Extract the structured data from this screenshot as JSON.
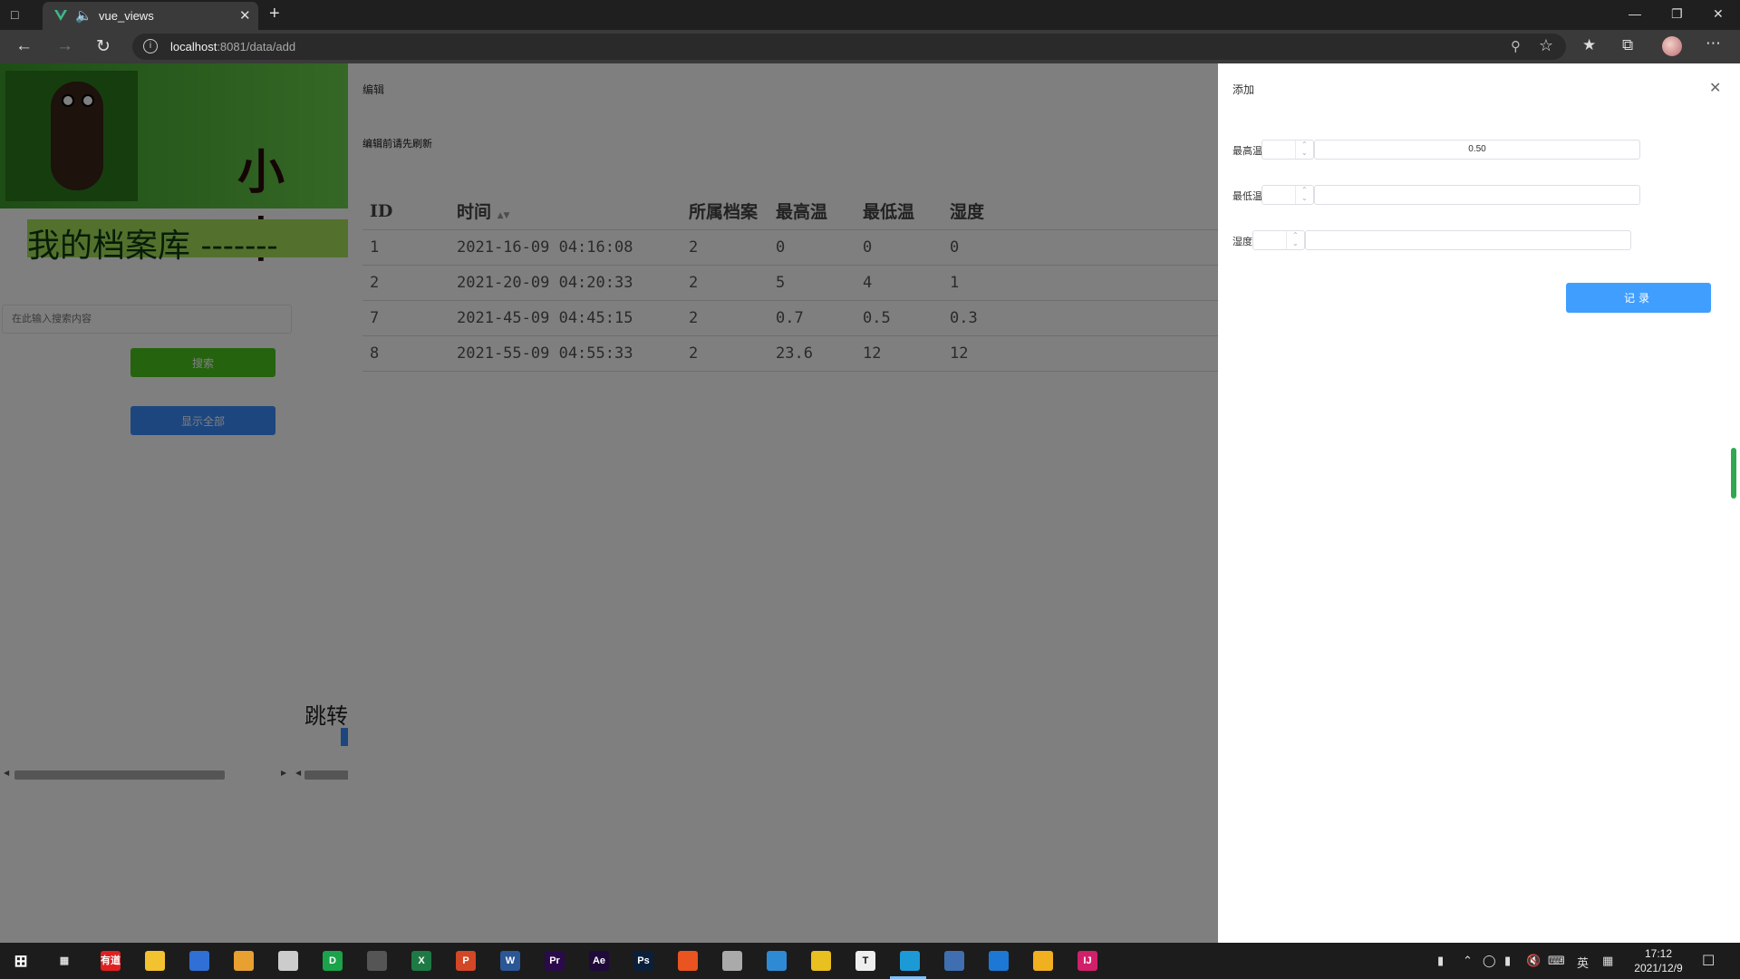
{
  "browser": {
    "tab_title": "vue_views",
    "url_host": "localhost",
    "url_rest": ":8081/data/add"
  },
  "background_page": {
    "banner_text": "小 中",
    "library_title": "我的档案库 -------",
    "search_placeholder": "在此输入搜索内容",
    "search_button": "搜索",
    "show_all_button": "显示全部",
    "jump_label": "跳转"
  },
  "edit_drawer": {
    "title": "编辑",
    "hint": "编辑前请先刷新",
    "columns": [
      "ID",
      "时间",
      "所属档案",
      "最高温",
      "最低温",
      "湿度"
    ],
    "rows": [
      {
        "id": "1",
        "time": "2021-16-09 04:16:08",
        "archive": "2",
        "max": "0",
        "min": "0",
        "humidity": "0"
      },
      {
        "id": "2",
        "time": "2021-20-09 04:20:33",
        "archive": "2",
        "max": "5",
        "min": "4",
        "humidity": "1"
      },
      {
        "id": "7",
        "time": "2021-45-09 04:45:15",
        "archive": "2",
        "max": "0.7",
        "min": "0.5",
        "humidity": "0.3"
      },
      {
        "id": "8",
        "time": "2021-55-09 04:55:33",
        "archive": "2",
        "max": "23.6",
        "min": "12",
        "humidity": "12"
      }
    ]
  },
  "add_drawer": {
    "title": "添加",
    "fields": [
      {
        "label": "最高温",
        "value": "0.50"
      },
      {
        "label": "最低温",
        "value": ""
      },
      {
        "label": "湿度",
        "value": ""
      }
    ],
    "submit_label": "记录"
  },
  "taskbar": {
    "apps": [
      {
        "name": "youdao",
        "label": "有道",
        "color": "#e02020"
      },
      {
        "name": "file-explorer",
        "label": "",
        "color": "#f2c230"
      },
      {
        "name": "mail",
        "label": "",
        "color": "#2f6fd6"
      },
      {
        "name": "bt",
        "label": "",
        "color": "#e8a030"
      },
      {
        "name": "files",
        "label": "",
        "color": "#ccc"
      },
      {
        "name": "d-app",
        "label": "D",
        "color": "#1aa34a"
      },
      {
        "name": "terminal",
        "label": "",
        "color": "#555"
      },
      {
        "name": "excel",
        "label": "X",
        "color": "#1e7a44"
      },
      {
        "name": "powerpoint",
        "label": "P",
        "color": "#d24726"
      },
      {
        "name": "word",
        "label": "W",
        "color": "#2b5797"
      },
      {
        "name": "premiere",
        "label": "Pr",
        "color": "#2a0a4a"
      },
      {
        "name": "after-effects",
        "label": "Ae",
        "color": "#1f0a3a"
      },
      {
        "name": "photoshop",
        "label": "Ps",
        "color": "#0a1f3a"
      },
      {
        "name": "ubuntu",
        "label": "",
        "color": "#e95420"
      },
      {
        "name": "app-b",
        "label": "",
        "color": "#aaa"
      },
      {
        "name": "app-c",
        "label": "",
        "color": "#2f8ad6"
      },
      {
        "name": "chrome",
        "label": "",
        "color": "#e8c020"
      },
      {
        "name": "typora",
        "label": "T",
        "color": "#eee"
      },
      {
        "name": "edge",
        "label": "",
        "color": "#1c9ad6"
      },
      {
        "name": "app-d",
        "label": "",
        "color": "#3f6fb0"
      },
      {
        "name": "vscode",
        "label": "",
        "color": "#1c78d4"
      },
      {
        "name": "app-e",
        "label": "",
        "color": "#f0b020"
      },
      {
        "name": "intellij",
        "label": "IJ",
        "color": "#d0206a"
      }
    ],
    "ime": "英",
    "time": "17:12",
    "date": "2021/12/9"
  }
}
